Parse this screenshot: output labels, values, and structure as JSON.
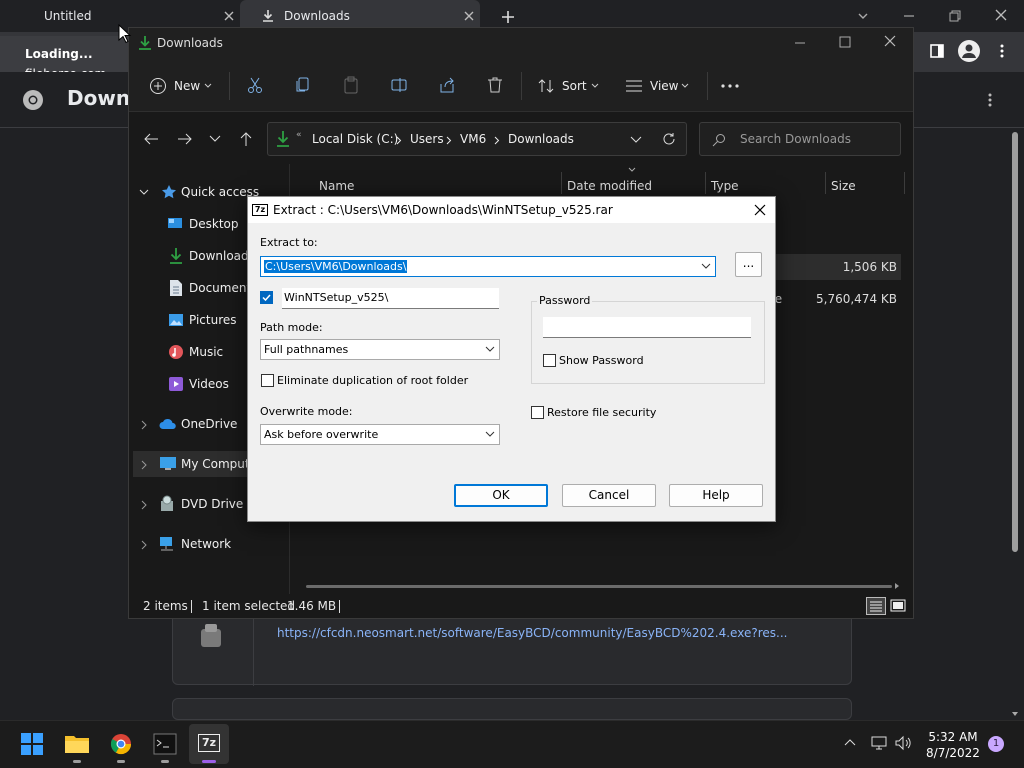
{
  "chrome": {
    "tabs": [
      {
        "label": "Untitled"
      },
      {
        "label": "Downloads"
      }
    ],
    "loading_title": "Loading...",
    "loading_host": "filehorse.com",
    "page_heading_partial": "Downl",
    "download_url": "https://cfcdn.neosmart.net/software/EasyBCD/community/EasyBCD%202.4.exe?res..."
  },
  "explorer": {
    "title": "Downloads",
    "toolbar": {
      "new": "New",
      "sort": "Sort",
      "view": "View"
    },
    "breadcrumb": [
      "Local Disk (C:)",
      "Users",
      "VM6",
      "Downloads"
    ],
    "search_placeholder": "Search Downloads",
    "sidebar": [
      {
        "label": "Quick access"
      },
      {
        "label": "Desktop"
      },
      {
        "label": "Downloads"
      },
      {
        "label": "Documents"
      },
      {
        "label": "Pictures"
      },
      {
        "label": "Music"
      },
      {
        "label": "Videos"
      },
      {
        "label": "OneDrive"
      },
      {
        "label": "My Compute"
      },
      {
        "label": "DVD Drive (F"
      },
      {
        "label": "Network"
      }
    ],
    "columns": {
      "name": "Name",
      "date": "Date modified",
      "type": "Type",
      "size": "Size"
    },
    "rows": [
      {
        "type": "",
        "size": "1,506 KB"
      },
      {
        "type": "File",
        "size": "5,760,474 KB"
      }
    ],
    "status": {
      "items": "2 items",
      "selected": "1 item selected",
      "size": "1.46 MB"
    }
  },
  "dialog": {
    "title": "Extract : C:\\Users\\VM6\\Downloads\\WinNTSetup_v525.rar",
    "extract_to_label": "Extract to:",
    "extract_to_value": "C:\\Users\\VM6\\Downloads\\",
    "browse_label": "...",
    "subfolder_value": "WinNTSetup_v525\\",
    "path_mode_label": "Path mode:",
    "path_mode_value": "Full pathnames",
    "eliminate_dup_label": "Eliminate duplication of root folder",
    "overwrite_mode_label": "Overwrite mode:",
    "overwrite_mode_value": "Ask before overwrite",
    "password_label": "Password",
    "show_password_label": "Show Password",
    "restore_security_label": "Restore file security",
    "ok_label": "OK",
    "cancel_label": "Cancel",
    "help_label": "Help"
  },
  "taskbar": {
    "time": "5:32 AM",
    "date": "8/7/2022",
    "notification_count": "1"
  },
  "colors": {
    "accent": "#0067c0",
    "folder_green": "#2ea043",
    "selection": "#0078d7"
  }
}
